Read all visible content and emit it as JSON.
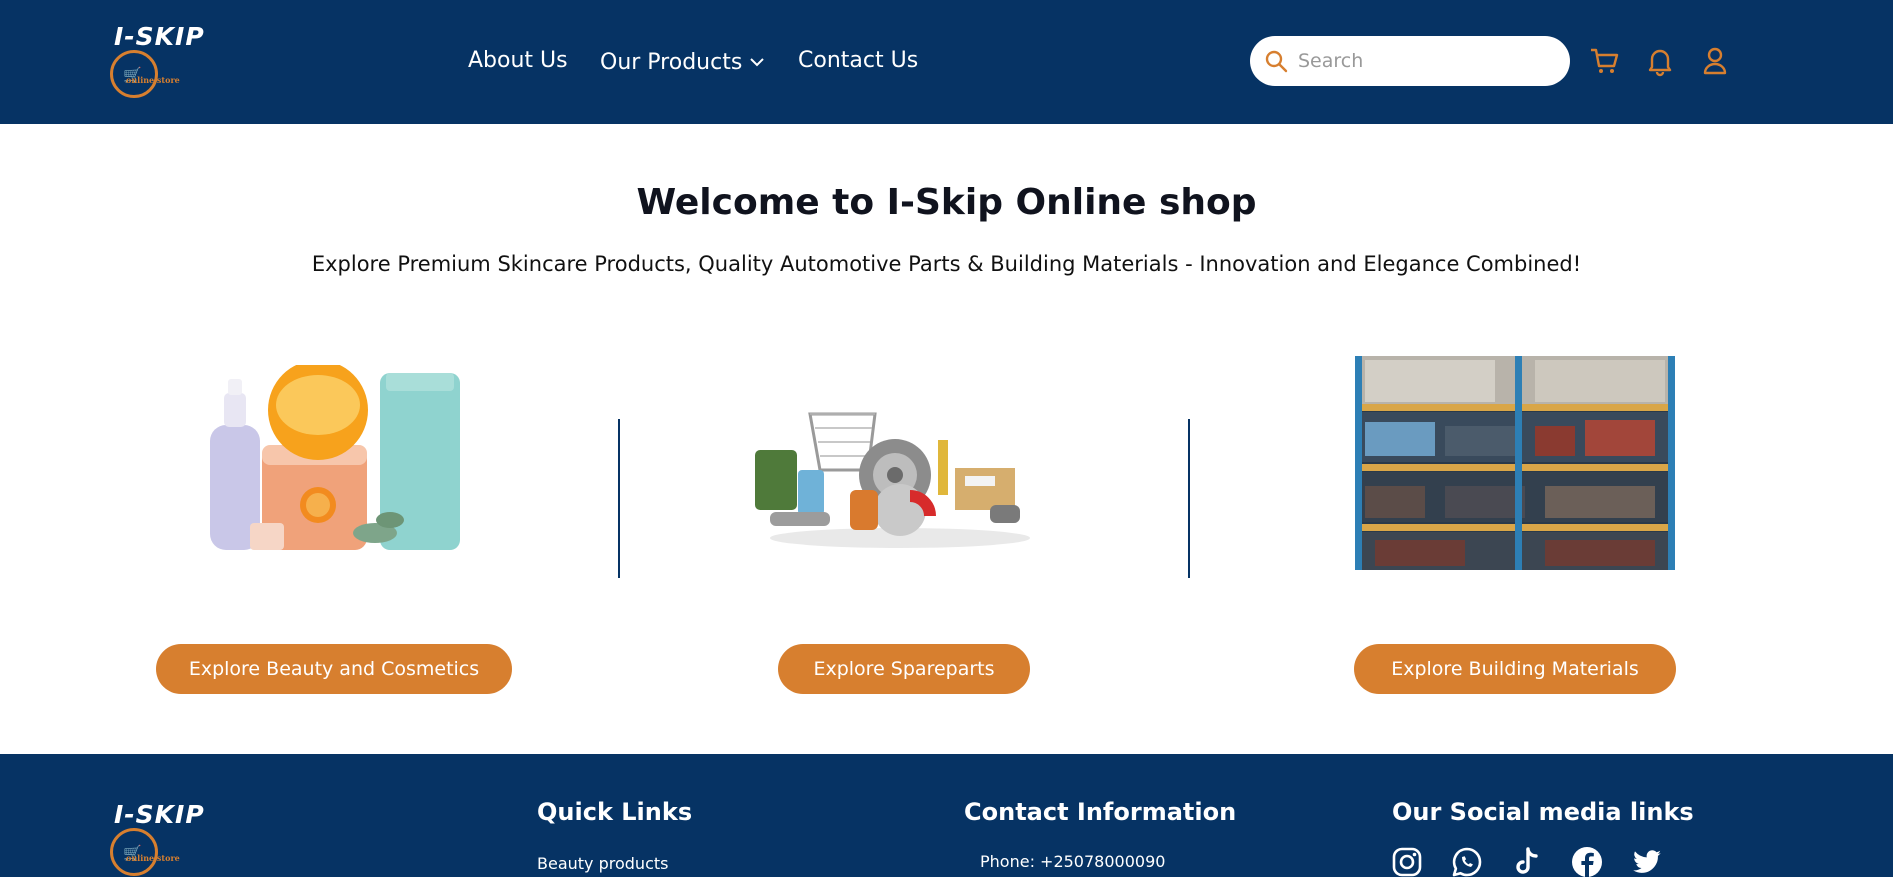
{
  "brand": {
    "name": "I-SKIP",
    "tagline": "online store"
  },
  "nav": {
    "about": "About Us",
    "products": "Our Products",
    "contact": "Contact Us"
  },
  "search": {
    "placeholder": "Search"
  },
  "hero": {
    "title": "Welcome to I-Skip Online shop",
    "subtitle": "Explore Premium Skincare Products, Quality Automotive Parts & Building Materials - Innovation and Elegance Combined!"
  },
  "categories": [
    {
      "button": "Explore Beauty and Cosmetics"
    },
    {
      "button": "Explore Spareparts"
    },
    {
      "button": "Explore Building Materials"
    }
  ],
  "footer": {
    "quick_links_heading": "Quick Links",
    "quick_links": [
      "Beauty products"
    ],
    "contact_heading": "Contact Information",
    "phone": "Phone: +25078000090",
    "social_heading": "Our Social media links",
    "social": [
      "instagram-icon",
      "whatsapp-icon",
      "tiktok-icon",
      "facebook-icon",
      "twitter-icon"
    ]
  },
  "colors": {
    "primary": "#063364",
    "accent": "#d77f2f",
    "white": "#ffffff"
  }
}
